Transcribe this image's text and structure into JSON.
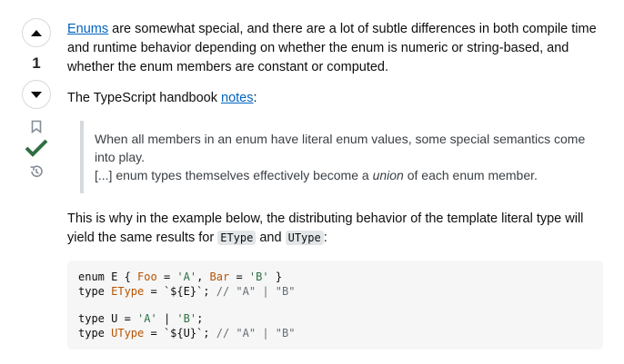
{
  "votes": {
    "count": "1"
  },
  "colors": {
    "accent_check": "#2f6f44",
    "link": "#0063bf"
  },
  "icons": {
    "upvote": "caret-up-icon",
    "downvote": "caret-down-icon",
    "bookmark": "bookmark-icon",
    "accepted": "check-icon",
    "history": "history-icon"
  },
  "post": {
    "p1": {
      "link": "Enums",
      "text": " are somewhat special, and there are a lot of subtle differences in both compile time and runtime behavior depending on whether the enum is numeric or string-based, and whether the enum members are constant or computed."
    },
    "p2": {
      "prefix": "The TypeScript handbook ",
      "link": "notes",
      "suffix": ":"
    },
    "quote": {
      "line1": "When all members in an enum have literal enum values, some special semantics come into play.",
      "line2_prefix": "[...] enum types themselves effectively become a ",
      "line2_em": "union",
      "line2_suffix": " of each enum member."
    },
    "p3": {
      "text1": "This is why in the example below, the distributing behavior of the template literal type will yield the same results for ",
      "code1": "EType",
      "text2": " and ",
      "code2": "UType",
      "text3": ":"
    },
    "code": {
      "l1": {
        "a": "enum E { ",
        "b": "Foo",
        "c": " = ",
        "d": "'A'",
        "e": ", ",
        "f": "Bar",
        "g": " = ",
        "h": "'B'",
        "i": " }"
      },
      "l2": {
        "a": "type ",
        "b": "EType",
        "c": " = ",
        "d": "`${E}`",
        "e": "; ",
        "f": "// \"A\" | \"B\""
      },
      "l3": {
        "a": "type U = ",
        "b": "'A'",
        "c": " | ",
        "d": "'B'",
        "e": ";"
      },
      "l4": {
        "a": "type ",
        "b": "UType",
        "c": " = ",
        "d": "`${U}`",
        "e": "; ",
        "f": "// \"A\" | \"B\""
      }
    }
  }
}
